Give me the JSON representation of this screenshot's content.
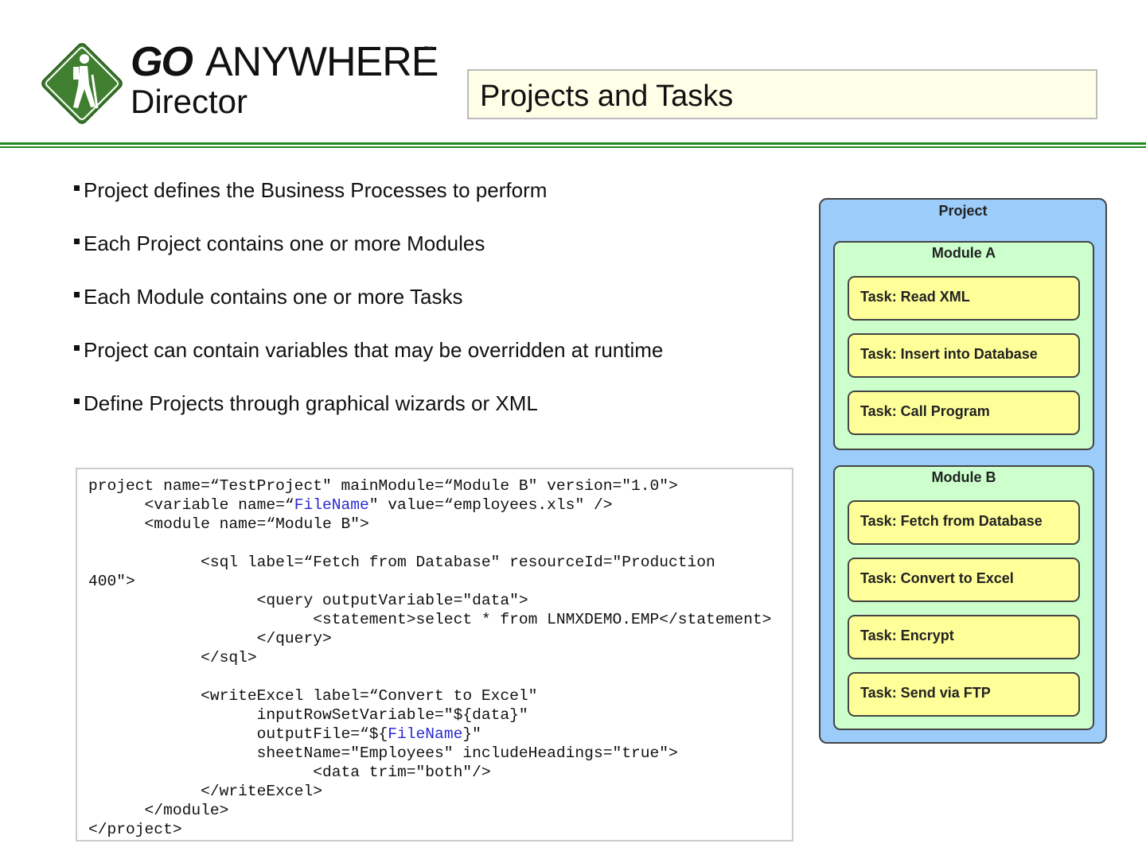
{
  "logo": {
    "go": "GO",
    "anywhere": "ANYWHERE",
    "tm": "TM",
    "director": "Director",
    "color": "#3f7f2f"
  },
  "title": "Projects and Tasks",
  "bullets": [
    "Project defines the Business Processes to perform",
    "Each Project contains one or more Modules",
    "Each Module contains one or more Tasks",
    "Project can contain variables that may be overridden at runtime",
    "Define Projects through graphical wizards or XML"
  ],
  "code_lines": [
    [
      "project name=“TestProject\" mainModule=“Module B\" version=\"1.0\">"
    ],
    [
      "      <variable name=“",
      "FileName",
      "\" value=“employees.xls\" />"
    ],
    [
      "      <module name=“Module B\">"
    ],
    [
      ""
    ],
    [
      "            <sql label=“Fetch from Database\" resourceId=\"Production"
    ],
    [
      "400\">"
    ],
    [
      "                  <query outputVariable=\"data\">"
    ],
    [
      "                        <statement>select * from LNMXDEMO.EMP</statement>"
    ],
    [
      "                  </query>"
    ],
    [
      "            </sql>"
    ],
    [
      ""
    ],
    [
      "            <writeExcel label=“Convert to Excel\""
    ],
    [
      "                  inputRowSetVariable=\"${data}\""
    ],
    [
      "                  outputFile=“${",
      "FileName",
      "}\""
    ],
    [
      "                  sheetName=\"Employees\" includeHeadings=\"true\">"
    ],
    [
      "                        <data trim=\"both\"/>"
    ],
    [
      "            </writeExcel>"
    ],
    [
      "      </module>"
    ],
    [
      "</project>"
    ]
  ],
  "diagram": {
    "project_label": "Project",
    "modules": [
      {
        "label": "Module A",
        "tasks": [
          "Task: Read XML",
          "Task: Insert into Database",
          "Task: Call Program"
        ]
      },
      {
        "label": "Module B",
        "tasks": [
          "Task: Fetch from Database",
          "Task: Convert to Excel",
          "Task: Encrypt",
          "Task: Send via FTP"
        ]
      }
    ]
  }
}
